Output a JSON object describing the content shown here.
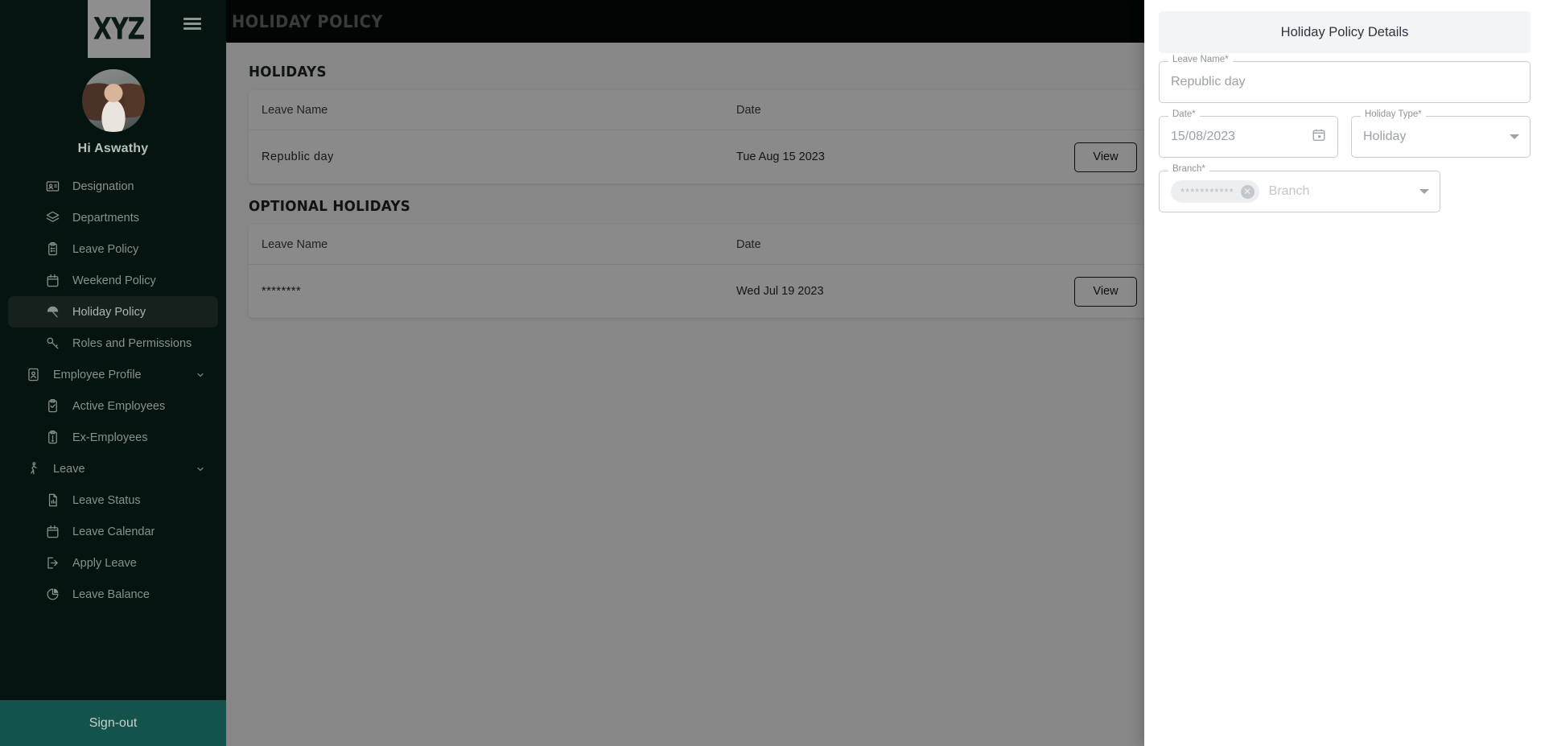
{
  "sidebar": {
    "logo_text": "XYZ",
    "greeting": "Hi Aswathy",
    "menu": [
      {
        "label": "Designation",
        "icon": "id-card-icon",
        "level": "sub",
        "active": false,
        "chevron": false
      },
      {
        "label": "Departments",
        "icon": "layers-icon",
        "level": "sub",
        "active": false,
        "chevron": false
      },
      {
        "label": "Leave Policy",
        "icon": "clipboard-list-icon",
        "level": "sub",
        "active": false,
        "chevron": false
      },
      {
        "label": "Weekend Policy",
        "icon": "calendar-icon",
        "level": "sub",
        "active": false,
        "chevron": false
      },
      {
        "label": "Holiday Policy",
        "icon": "umbrella-icon",
        "level": "sub",
        "active": true,
        "chevron": false
      },
      {
        "label": "Roles and Permissions",
        "icon": "key-icon",
        "level": "sub",
        "active": false,
        "chevron": false
      },
      {
        "label": "Employee Profile",
        "icon": "user-badge-icon",
        "level": "group",
        "active": false,
        "chevron": true
      },
      {
        "label": "Active Employees",
        "icon": "clipboard-check-icon",
        "level": "sub",
        "active": false,
        "chevron": false
      },
      {
        "label": "Ex-Employees",
        "icon": "clipboard-alert-icon",
        "level": "sub",
        "active": false,
        "chevron": false
      },
      {
        "label": "Leave",
        "icon": "walking-icon",
        "level": "group",
        "active": false,
        "chevron": true
      },
      {
        "label": "Leave Status",
        "icon": "file-chart-icon",
        "level": "sub",
        "active": false,
        "chevron": false
      },
      {
        "label": "Leave Calendar",
        "icon": "calendar-icon",
        "level": "sub",
        "active": false,
        "chevron": false
      },
      {
        "label": "Apply Leave",
        "icon": "logout-arrow-icon",
        "level": "sub",
        "active": false,
        "chevron": false
      },
      {
        "label": "Leave Balance",
        "icon": "pie-chart-icon",
        "level": "sub",
        "active": false,
        "chevron": false
      }
    ],
    "signout_label": "Sign-out"
  },
  "topbar": {
    "title": "HOLIDAY POLICY",
    "menu_icon": "hamburger-icon"
  },
  "main": {
    "sections": [
      {
        "title": "HOLIDAYS",
        "columns": {
          "name": "Leave Name",
          "date": "Date"
        },
        "rows": [
          {
            "name": "Republic day",
            "date": "Tue Aug 15 2023",
            "action": "View"
          }
        ]
      },
      {
        "title": "OPTIONAL HOLIDAYS",
        "columns": {
          "name": "Leave Name",
          "date": "Date"
        },
        "rows": [
          {
            "name": "********",
            "date": "Wed Jul 19 2023",
            "action": "View"
          }
        ]
      }
    ]
  },
  "panel": {
    "title": "Holiday Policy Details",
    "leave_name": {
      "label": "Leave Name*",
      "value": "Republic day"
    },
    "date": {
      "label": "Date*",
      "value": "15/08/2023",
      "icon": "calendar-picker-icon"
    },
    "holiday_type": {
      "label": "Holiday Type*",
      "value": "Holiday",
      "icon": "chevron-down-icon"
    },
    "branch": {
      "label": "Branch*",
      "chip_text": "***********",
      "chip_remove_icon": "cancel-icon",
      "placeholder": "Branch",
      "icon": "chevron-down-icon"
    }
  },
  "colors": {
    "sidebar_bg": "#041410",
    "topbar_bg": "#04140f",
    "signout_bg": "#14534b",
    "active_item_bg": "#16201c",
    "panel_header_bg": "#f3f4f5",
    "content_bg": "#fafafa"
  }
}
